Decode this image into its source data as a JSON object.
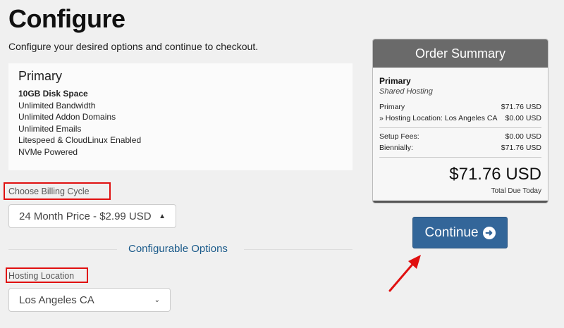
{
  "header": {
    "title": "Configure",
    "subtitle": "Configure your desired options and continue to checkout."
  },
  "product": {
    "name": "Primary",
    "features": [
      "10GB Disk Space",
      "Unlimited Bandwidth",
      "Unlimited Addon Domains",
      "Unlimited Emails",
      "Litespeed & CloudLinux Enabled",
      "NVMe Powered"
    ]
  },
  "billing": {
    "label": "Choose Billing Cycle",
    "selected": "24 Month Price - $2.99 USD"
  },
  "configurable": {
    "heading": "Configurable Options",
    "location_label": "Hosting Location",
    "location_selected": "Los Angeles CA"
  },
  "summary": {
    "title": "Order Summary",
    "product": "Primary",
    "group": "Shared Hosting",
    "lines": [
      {
        "label": "Primary",
        "value": "$71.76 USD"
      },
      {
        "label": "» Hosting Location: Los Angeles CA",
        "value": "$0.00 USD"
      }
    ],
    "fees": [
      {
        "label": "Setup Fees:",
        "value": "$0.00 USD"
      },
      {
        "label": "Biennially:",
        "value": "$71.76 USD"
      }
    ],
    "total": "$71.76 USD",
    "total_label": "Total Due Today"
  },
  "actions": {
    "continue_label": "Continue"
  },
  "colors": {
    "accent": "#336699",
    "highlight": "#e01010",
    "summary_header": "#6a6a6a"
  }
}
